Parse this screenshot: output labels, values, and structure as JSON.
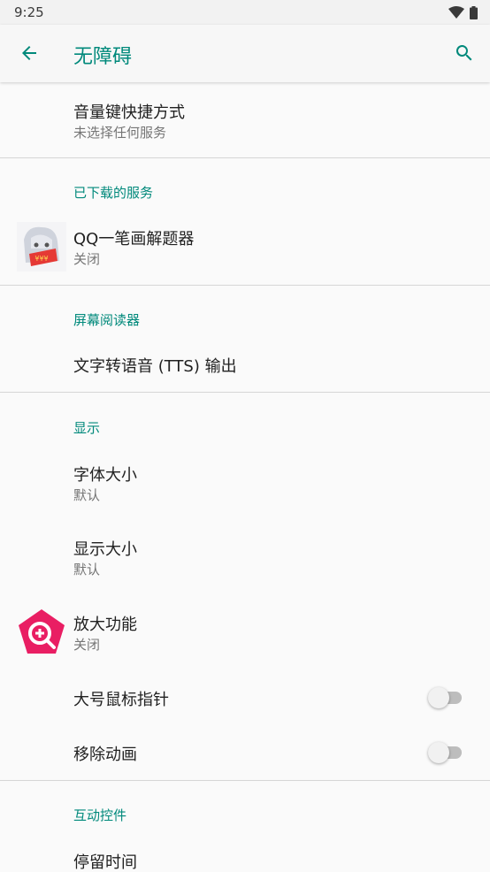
{
  "status": {
    "time": "9:25"
  },
  "appbar": {
    "title": "无障碍"
  },
  "items": {
    "shortcut": {
      "title": "音量键快捷方式",
      "summary": "未选择任何服务"
    },
    "downloaded_header": "已下载的服务",
    "qq": {
      "title": "QQ一笔画解题器",
      "summary": "关闭"
    },
    "reader_header": "屏幕阅读器",
    "tts": {
      "title": "文字转语音 (TTS) 输出"
    },
    "display_header": "显示",
    "font_size": {
      "title": "字体大小",
      "summary": "默认"
    },
    "display_size": {
      "title": "显示大小",
      "summary": "默认"
    },
    "magnify": {
      "title": "放大功能",
      "summary": "关闭"
    },
    "large_pointer": {
      "title": "大号鼠标指针",
      "enabled": false
    },
    "remove_anim": {
      "title": "移除动画",
      "enabled": false
    },
    "interaction_header": "互动控件",
    "dwell": {
      "title": "停留时间"
    }
  },
  "colors": {
    "accent": "#00897b",
    "magnify_icon": "#e91e63"
  }
}
